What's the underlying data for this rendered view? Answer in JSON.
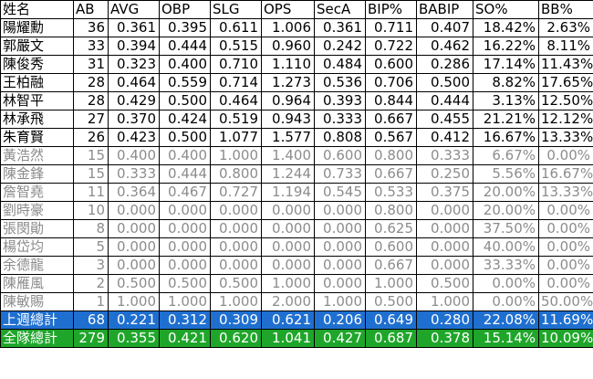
{
  "table": {
    "headers": [
      "姓名",
      "AB",
      "AVG",
      "OBP",
      "SLG",
      "OPS",
      "SecA",
      "BIP%",
      "BABIP",
      "SO%",
      "BB%"
    ],
    "rows": [
      {
        "status": "active",
        "cells": [
          "陽耀勳",
          "36",
          "0.361",
          "0.395",
          "0.611",
          "1.006",
          "0.361",
          "0.711",
          "0.407",
          "18.42%",
          "2.63%"
        ]
      },
      {
        "status": "active",
        "cells": [
          "郭嚴文",
          "33",
          "0.394",
          "0.444",
          "0.515",
          "0.960",
          "0.242",
          "0.722",
          "0.462",
          "16.22%",
          "8.11%"
        ]
      },
      {
        "status": "active",
        "cells": [
          "陳俊秀",
          "31",
          "0.323",
          "0.400",
          "0.710",
          "1.110",
          "0.484",
          "0.600",
          "0.286",
          "17.14%",
          "11.43%"
        ]
      },
      {
        "status": "active",
        "cells": [
          "王柏融",
          "28",
          "0.464",
          "0.559",
          "0.714",
          "1.273",
          "0.536",
          "0.706",
          "0.500",
          "8.82%",
          "17.65%"
        ]
      },
      {
        "status": "active",
        "cells": [
          "林智平",
          "28",
          "0.429",
          "0.500",
          "0.464",
          "0.964",
          "0.393",
          "0.844",
          "0.444",
          "3.13%",
          "12.50%"
        ]
      },
      {
        "status": "active",
        "cells": [
          "林承飛",
          "27",
          "0.370",
          "0.424",
          "0.519",
          "0.943",
          "0.333",
          "0.667",
          "0.455",
          "21.21%",
          "12.12%"
        ]
      },
      {
        "status": "active",
        "cells": [
          "朱育賢",
          "26",
          "0.423",
          "0.500",
          "1.077",
          "1.577",
          "0.808",
          "0.567",
          "0.412",
          "16.67%",
          "13.33%"
        ]
      },
      {
        "status": "inactive",
        "cells": [
          "黃浩然",
          "15",
          "0.400",
          "0.400",
          "1.000",
          "1.400",
          "0.600",
          "0.800",
          "0.333",
          "6.67%",
          "0.00%"
        ]
      },
      {
        "status": "inactive",
        "cells": [
          "陳金鋒",
          "15",
          "0.333",
          "0.444",
          "0.800",
          "1.244",
          "0.733",
          "0.667",
          "0.250",
          "5.56%",
          "16.67%"
        ]
      },
      {
        "status": "inactive",
        "cells": [
          "詹智堯",
          "11",
          "0.364",
          "0.467",
          "0.727",
          "1.194",
          "0.545",
          "0.533",
          "0.375",
          "20.00%",
          "13.33%"
        ]
      },
      {
        "status": "inactive",
        "cells": [
          "劉時豪",
          "10",
          "0.000",
          "0.000",
          "0.000",
          "0.000",
          "0.000",
          "0.800",
          "0.000",
          "20.00%",
          "0.00%"
        ]
      },
      {
        "status": "inactive",
        "cells": [
          "張閔勛",
          "8",
          "0.000",
          "0.000",
          "0.000",
          "0.000",
          "0.000",
          "0.625",
          "0.000",
          "37.50%",
          "0.00%"
        ]
      },
      {
        "status": "inactive",
        "cells": [
          "楊岱均",
          "5",
          "0.000",
          "0.000",
          "0.000",
          "0.000",
          "0.000",
          "0.600",
          "0.000",
          "40.00%",
          "0.00%"
        ]
      },
      {
        "status": "inactive",
        "cells": [
          "余德龍",
          "3",
          "0.000",
          "0.000",
          "0.000",
          "0.000",
          "0.000",
          "0.667",
          "0.000",
          "33.33%",
          "0.00%"
        ]
      },
      {
        "status": "inactive",
        "cells": [
          "陳雁風",
          "2",
          "0.500",
          "0.500",
          "0.500",
          "1.000",
          "0.000",
          "1.000",
          "0.500",
          "0.00%",
          "0.00%"
        ]
      },
      {
        "status": "inactive",
        "cells": [
          "陳敏賜",
          "1",
          "1.000",
          "1.000",
          "1.000",
          "2.000",
          "1.000",
          "0.500",
          "1.000",
          "0.00%",
          "50.00%"
        ]
      },
      {
        "status": "week",
        "cells": [
          "上週總計",
          "68",
          "0.221",
          "0.312",
          "0.309",
          "0.621",
          "0.206",
          "0.649",
          "0.280",
          "22.08%",
          "11.69%"
        ]
      },
      {
        "status": "total",
        "cells": [
          "全隊總計",
          "279",
          "0.355",
          "0.421",
          "0.620",
          "1.041",
          "0.427",
          "0.687",
          "0.378",
          "15.14%",
          "10.09%"
        ]
      }
    ]
  },
  "colors": {
    "inactive_text": "#8c8c8c",
    "week_total_bg": "#1f6fd0",
    "team_total_bg": "#1fa62a",
    "border": "#000000"
  }
}
